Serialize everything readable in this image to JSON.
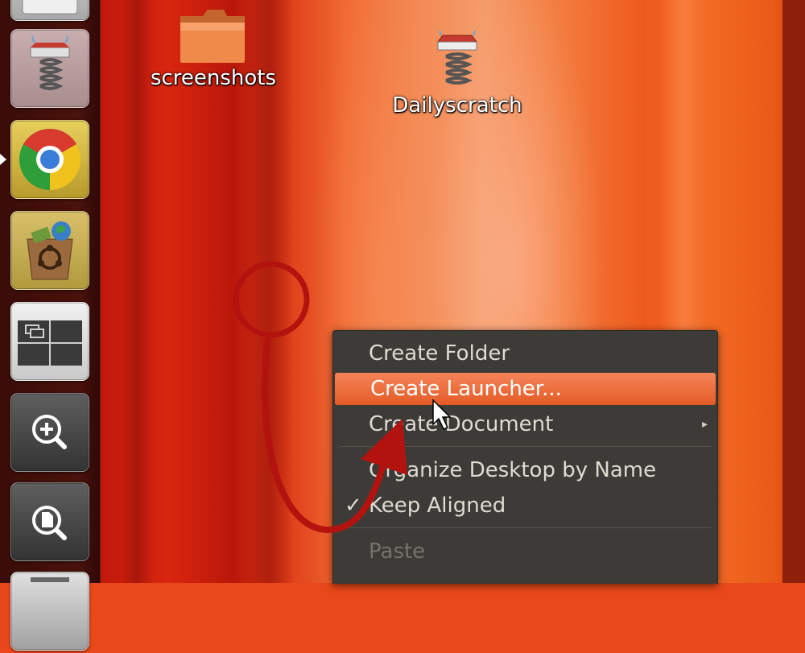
{
  "launcher": {
    "items": [
      {
        "name": "home-folder"
      },
      {
        "name": "dailyscratch-app"
      },
      {
        "name": "chrome-browser"
      },
      {
        "name": "ubuntu-software-center"
      },
      {
        "name": "workspace-switcher"
      },
      {
        "name": "zoom-in-tool"
      },
      {
        "name": "document-search"
      },
      {
        "name": "trash"
      }
    ]
  },
  "desktop": {
    "icons": [
      {
        "label": "screenshots",
        "icon": "folder-icon"
      },
      {
        "label": "Dailyscratch",
        "icon": "spring-app-icon"
      }
    ]
  },
  "context_menu": {
    "items": [
      {
        "label": "Create Folder",
        "state": "normal"
      },
      {
        "label": "Create Launcher...",
        "state": "highlighted"
      },
      {
        "label": "Create Document",
        "state": "normal",
        "submenu": true
      },
      {
        "label": "Organize Desktop by Name",
        "state": "normal"
      },
      {
        "label": "Keep Aligned",
        "state": "checked"
      },
      {
        "label": "Paste",
        "state": "disabled"
      }
    ],
    "submenu_arrow": "▸",
    "checkmark": "✓"
  },
  "colors": {
    "menu_bg": "#3d3b37",
    "menu_highlight": "#e35b25",
    "annotation": "#b3130f"
  }
}
